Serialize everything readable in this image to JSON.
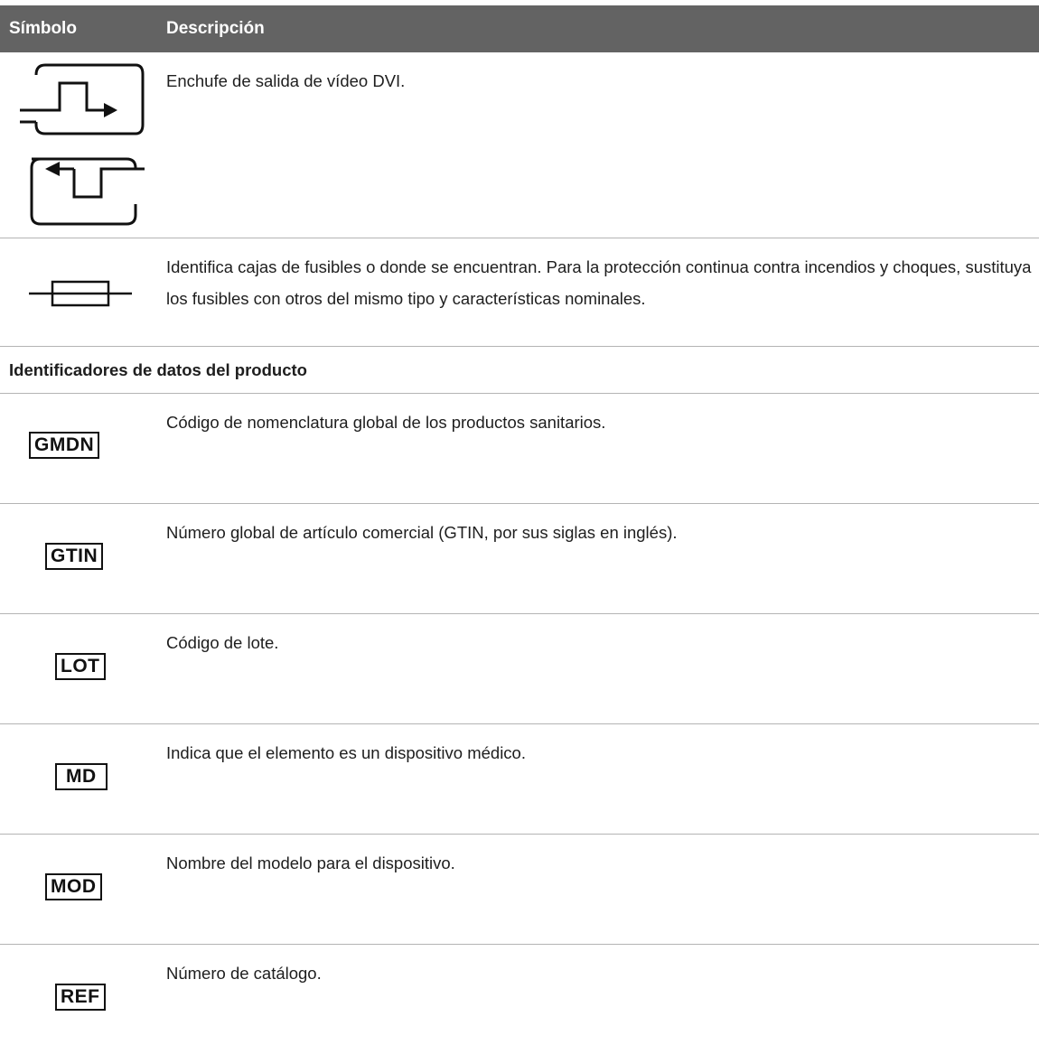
{
  "header": {
    "symbol_col": "Símbolo",
    "description_col": "Descripción"
  },
  "rows": [
    {
      "icon": "dvi-video-output-icon",
      "description": "Enchufe de salida de vídeo DVI."
    },
    {
      "icon": "fuse-icon",
      "description": "Identifica cajas de fusibles o donde se encuentran. Para la protección continua contra incendios y choques, sustituya los fusibles con otros del mismo tipo y características nominales."
    }
  ],
  "section_title": "Identificadores de datos del producto",
  "identifiers": [
    {
      "label": "GMDN",
      "description": "Código de nomenclatura global de los productos sanitarios."
    },
    {
      "label": "GTIN",
      "description": "Número global de artículo comercial (GTIN, por sus siglas en inglés)."
    },
    {
      "label": "LOT",
      "description": "Código de lote."
    },
    {
      "label": "MD",
      "description": "Indica que el elemento es un dispositivo médico."
    },
    {
      "label": "MOD",
      "description": "Nombre del modelo para el dispositivo."
    },
    {
      "label": "REF",
      "description": "Número de catálogo."
    }
  ]
}
